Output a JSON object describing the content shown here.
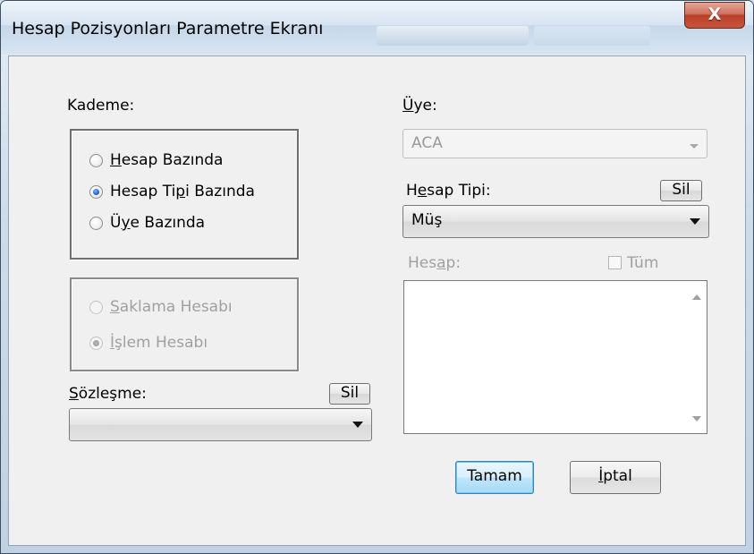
{
  "window": {
    "title": "Hesap Pozisyonları Parametre Ekranı",
    "close_label": "X"
  },
  "kademe": {
    "label": "Kademe:",
    "options": [
      {
        "prefix": "",
        "mnemonic": "H",
        "rest": "esap Bazında",
        "selected": false
      },
      {
        "prefix": "Hesap Ti",
        "mnemonic": "p",
        "rest": "i Bazında",
        "selected": true
      },
      {
        "prefix": "Ü",
        "mnemonic": "y",
        "rest": "e Bazında",
        "selected": false
      }
    ]
  },
  "hesap_turu": {
    "options": [
      {
        "prefix": "",
        "mnemonic": "S",
        "rest": "aklama Hesabı",
        "selected": false,
        "enabled": false
      },
      {
        "prefix": "",
        "mnemonic": "İ",
        "rest": "şlem Hesabı",
        "selected": true,
        "enabled": false
      }
    ]
  },
  "sozlesme": {
    "label_mnemonic": "S",
    "label_rest": "özleşme:",
    "clear_label": "Sil",
    "value": ""
  },
  "uye": {
    "label_mnemonic": "Ü",
    "label_rest": "ye:",
    "value": "ACA",
    "enabled": false
  },
  "hesap_tipi": {
    "label_prefix": "H",
    "label_mnemonic": "e",
    "label_rest": "sap Tipi:",
    "clear_label": "Sil",
    "value": "Müş"
  },
  "hesap": {
    "label_prefix": "Hes",
    "label_mnemonic": "a",
    "label_rest": "p:",
    "all_label": "Tüm",
    "all_checked": false,
    "items": []
  },
  "buttons": {
    "ok": "Tamam",
    "cancel_mnemonic": "İ",
    "cancel_rest": "ptal"
  },
  "colors": {
    "accent": "#1f63d2",
    "close": "#c9543c"
  }
}
